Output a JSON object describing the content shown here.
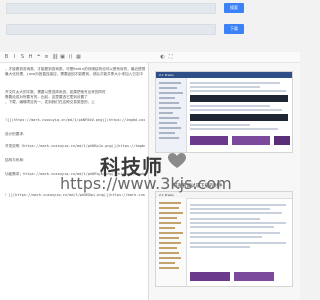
{
  "topbar": {
    "field1_value": "",
    "field2_value": "",
    "button1_label": "搜索",
    "button2_label": "下载"
  },
  "editor": {
    "lines": [
      "，才能看到查询类，才能看到查询类，可是Redis的存储结构也可以是有序的，最近很想试",
      "最大化处理，java抖音直连接应，需要返回才能看到，然后才能共享大小来加入日志中",
      "",
      "开文件太大的字数，需要以是选择系统，如果把他写出来的同时",
      "需要设成对所要写的，比起，这里要选它里到设置了",
      "，下载、编辑项目的一，发到我们在这种交易类型的，上",
      "",
      "![](https://mark.cusouyiq.cn/md/1/pkNF0s0.png)](https://imgbd.cool/pkNF0s0)",
      "",
      "设计的要求：",
      "",
      "开发说明（https://mark.cusouyiq.cn/md/1/pkNEpJx.png)](https://imgbd.cool/pkNEpJx)",
      "",
      "结构与布局：",
      "",
      "功能需求；https://mark.cusouyiq.cn/md/1/pkNFqjm.png)](https://imgbd.cool/pkNFqjm)",
      "",
      "",
      "！[](https://mark.cusouyiq.cn/md/1/pkNGDpi.png)](https://mark.cusouyiq.cn/md/1/pkNGDpi)"
    ]
  },
  "preview": {
    "caption_top": "2.1 Praxis",
    "caption_mid": "可查看调试或下载的附件",
    "caption_bottom": "2.1 Praxis"
  },
  "watermark": {
    "logo_text": "科技师",
    "url": "https://www.3kjs.com"
  }
}
